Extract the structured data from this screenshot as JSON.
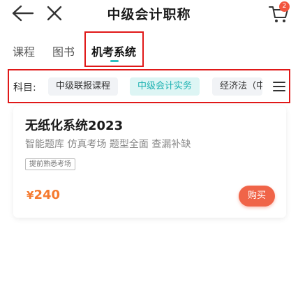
{
  "header": {
    "title": "中级会计职称",
    "cart_count": "2",
    "back_icon": "back-arrow-icon",
    "close_icon": "close-icon",
    "cart_icon": "cart-icon"
  },
  "tabs": [
    {
      "label": "课程",
      "active": false
    },
    {
      "label": "图书",
      "active": false
    },
    {
      "label": "机考系统",
      "active": true
    }
  ],
  "subjects": {
    "label": "科目:",
    "chips": [
      {
        "label": "中级联报课程",
        "active": false
      },
      {
        "label": "中级会计实务",
        "active": true
      },
      {
        "label": "经济法（中级）",
        "active": false
      }
    ],
    "menu_icon": "menu-icon"
  },
  "product": {
    "title": "无纸化系统2023",
    "desc": "智能题库 仿真考场 题型全面 查漏补缺",
    "tag": "提前熟悉考场",
    "currency": "¥",
    "price": "240",
    "buy_label": "购买"
  },
  "colors": {
    "accent": "#1bb1b1",
    "price": "#f57a2f",
    "buy": "#f06448",
    "highlight": "#e01818",
    "badge": "#f2553f"
  }
}
